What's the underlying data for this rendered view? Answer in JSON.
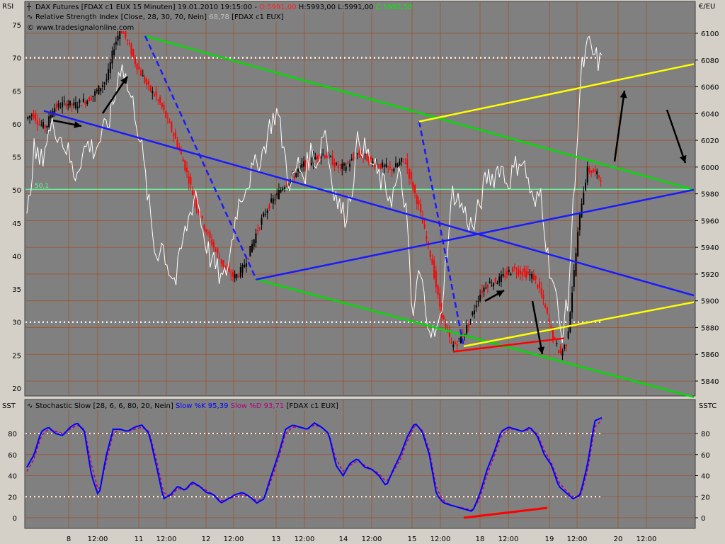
{
  "price_panel": {
    "left_label": "RSI",
    "right_label": "€/EU",
    "legend": {
      "line1_prefix": "DAX Futures [FDAX c1 EUX  15 Minuten] 19.01.2010 19:15:00 - ",
      "open": "O:5991,00",
      "high_low": " H:5993,00 L:5991,00 ",
      "close": "C:5992,50",
      "line2": "Relative Strength Index [Close, 28, 30, 70, Nein]",
      "rsi_value": "68,78",
      "line2_suffix": "[FDAX c1 EUX]",
      "copyright": "© www.tradesignalonline.com"
    },
    "rsi_axis_ticks": [
      "75",
      "70",
      "65",
      "60",
      "55",
      "50",
      "45",
      "40",
      "35",
      "30",
      "25",
      "20"
    ],
    "price_axis_ticks": [
      "6100",
      "6080",
      "6060",
      "6040",
      "6020",
      "6000",
      "5980",
      "5960",
      "5940",
      "5920",
      "5900",
      "5880",
      "5860",
      "5840"
    ],
    "level_label": "50,1"
  },
  "stoch_panel": {
    "left_label": "SST",
    "right_label": "SSTC",
    "legend": {
      "name": "Stochastic Slow [28, 6, 6, 80, 20, Nein]",
      "k": "Slow %K 95,39",
      "d": "Slow %D 93,71",
      "suffix": "[FDAX c1 EUX]"
    },
    "axis_ticks": [
      "80",
      "60",
      "40",
      "20",
      "0"
    ]
  },
  "time_axis": [
    "8",
    "12:00",
    "11",
    "12:00",
    "12",
    "12:00",
    "13",
    "12:00",
    "14",
    "12:00",
    "15",
    "12:00",
    "18",
    "12:00",
    "19",
    "12:00",
    "20",
    "12:00"
  ],
  "colors": {
    "panel_bg": "#808080",
    "chrome_bg": "#d4d0c8",
    "grid": "#a0522d",
    "rsi_line": "#ffffff",
    "up_candle": "#000000",
    "down_candle": "#ff0000",
    "trend_green": "#00dd00",
    "trend_blue": "#1a1aff",
    "trend_yellow": "#ffff00",
    "trend_red": "#ff0000",
    "stoch_k": "#0000ff",
    "stoch_d": "#b00080",
    "level_line": "#66ff99"
  },
  "chart_data": [
    {
      "type": "line",
      "name": "Relative Strength Index",
      "y_left_range": [
        18,
        77
      ],
      "y_right_range": [
        5830,
        6110
      ],
      "x_range": [
        "08.01.2010",
        "20.01.2010"
      ],
      "levels": [
        30,
        50.1,
        70
      ],
      "rsi_last": 68.78,
      "price_last": {
        "open": 5991.0,
        "high": 5993.0,
        "low": 5991.0,
        "close": 5992.5
      },
      "price_path": [
        6036,
        6040,
        6032,
        6030,
        6044,
        6046,
        6048,
        6046,
        6048,
        6050,
        6054,
        6060,
        6066,
        6090,
        6104,
        6094,
        6080,
        6070,
        6060,
        6054,
        6046,
        6034,
        6022,
        6008,
        5992,
        5974,
        5960,
        5948,
        5938,
        5928,
        5920,
        5918,
        5924,
        5936,
        5950,
        5962,
        5972,
        5978,
        5986,
        5990,
        5996,
        6002,
        6004,
        6008,
        6010,
        6006,
        6000,
        6000,
        6004,
        6010,
        6008,
        6004,
        6002,
        6000,
        5998,
        6002,
        6006,
        5988,
        5972,
        5950,
        5930,
        5900,
        5880,
        5866,
        5870,
        5878,
        5890,
        5904,
        5912,
        5914,
        5916,
        5920,
        5924,
        5922,
        5920,
        5918,
        5908,
        5890,
        5872,
        5860,
        5870,
        5920,
        5970,
        5998,
        5996,
        5992
      ],
      "rsi_path": [
        45,
        56,
        54,
        58,
        60,
        58,
        56,
        52,
        55,
        57,
        56,
        58,
        60,
        64,
        70,
        65,
        62,
        56,
        48,
        40,
        42,
        38,
        36,
        42,
        46,
        50,
        44,
        40,
        38,
        36,
        40,
        47,
        50,
        52,
        54,
        56,
        60,
        62,
        56,
        50,
        54,
        52,
        56,
        54,
        60,
        52,
        48,
        46,
        50,
        58,
        56,
        54,
        52,
        50,
        49,
        52,
        48,
        30,
        38,
        32,
        28,
        29,
        40,
        50,
        48,
        46,
        44,
        48,
        52,
        52,
        54,
        51,
        53,
        55,
        52,
        47,
        50,
        40,
        35,
        28,
        33,
        52,
        68,
        72,
        70,
        69
      ]
    },
    {
      "type": "line",
      "name": "Stochastic Slow",
      "ylim": [
        -5,
        98
      ],
      "levels": [
        20,
        80
      ],
      "series": [
        {
          "name": "Slow %K",
          "last": 95.39,
          "values": [
            48,
            60,
            82,
            86,
            80,
            78,
            86,
            90,
            82,
            40,
            20,
            58,
            84,
            84,
            82,
            86,
            88,
            80,
            50,
            18,
            22,
            30,
            26,
            34,
            30,
            24,
            22,
            14,
            18,
            22,
            24,
            20,
            14,
            18,
            40,
            60,
            84,
            88,
            86,
            84,
            90,
            86,
            80,
            50,
            40,
            52,
            56,
            48,
            46,
            40,
            30,
            46,
            60,
            78,
            90,
            82,
            60,
            22,
            14,
            12,
            10,
            8,
            6,
            22,
            45,
            62,
            82,
            86,
            84,
            82,
            86,
            78,
            60,
            50,
            30,
            24,
            18,
            22,
            50,
            92,
            95
          ]
        },
        {
          "name": "Slow %D",
          "last": 93.71,
          "values": [
            44,
            56,
            78,
            84,
            82,
            80,
            84,
            88,
            84,
            50,
            24,
            52,
            80,
            84,
            82,
            84,
            86,
            82,
            56,
            24,
            20,
            28,
            26,
            32,
            30,
            26,
            22,
            16,
            18,
            20,
            22,
            20,
            16,
            18,
            36,
            56,
            80,
            86,
            86,
            84,
            88,
            86,
            80,
            56,
            44,
            50,
            54,
            50,
            46,
            42,
            34,
            44,
            56,
            74,
            88,
            84,
            64,
            28,
            16,
            12,
            10,
            9,
            7,
            18,
            40,
            58,
            78,
            84,
            84,
            82,
            84,
            80,
            64,
            52,
            34,
            26,
            20,
            20,
            44,
            86,
            93
          ]
        }
      ]
    }
  ]
}
